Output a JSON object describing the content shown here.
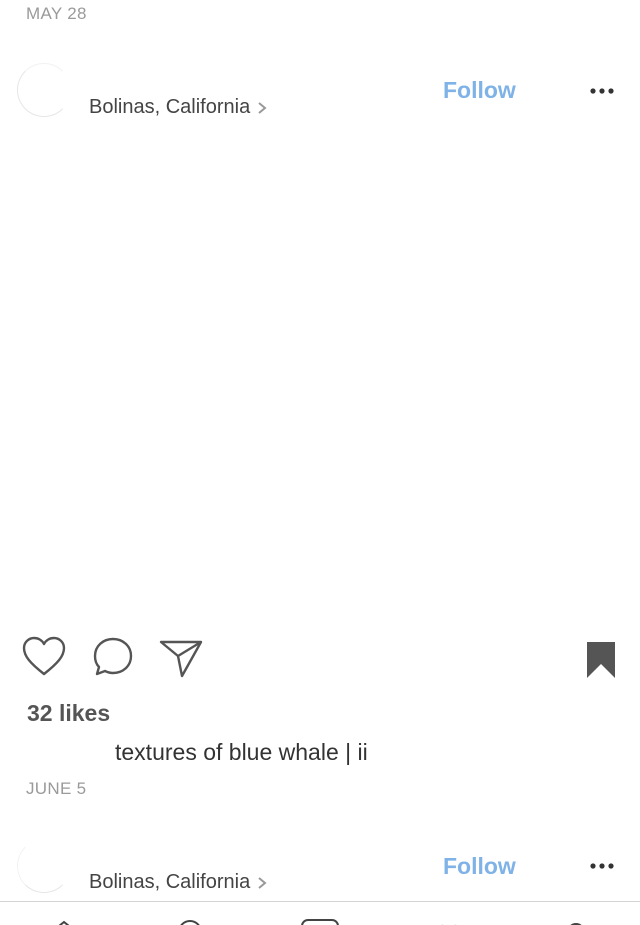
{
  "posts": [
    {
      "date": "MAY 28",
      "location": "Bolinas, California",
      "follow_label": "Follow",
      "more_icon": "ellipsis-icon",
      "likes": "32 likes",
      "caption": "textures of blue whale | ii"
    },
    {
      "date": "JUNE 5",
      "location": "Bolinas, California",
      "follow_label": "Follow",
      "more_icon": "ellipsis-icon"
    }
  ],
  "actions": {
    "like_icon": "heart-icon",
    "comment_icon": "comment-icon",
    "share_icon": "send-icon",
    "save_icon": "bookmark-icon"
  },
  "colors": {
    "follow": "#7fb2e6",
    "muted": "#9a9a9a",
    "icon": "#555555"
  }
}
